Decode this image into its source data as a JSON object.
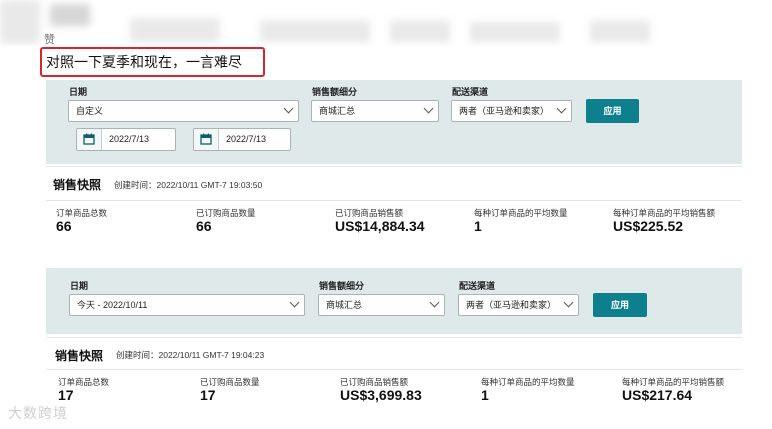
{
  "header": {
    "author_label": "赞",
    "comment": "对照一下夏季和现在，一言难尽"
  },
  "icons": {
    "calendar": "calendar-icon",
    "chevron": "chevron-down-icon"
  },
  "colors": {
    "accent": "#0e7f8d",
    "panel": "#dfe9ea",
    "highlight": "#d9242b"
  },
  "report1": {
    "filters": {
      "date_label": "日期",
      "date_value": "自定义",
      "start_date": "2022/7/13",
      "end_date": "2022/7/13",
      "breakdown_label": "销售额细分",
      "breakdown_value": "商城汇总",
      "channel_label": "配送渠道",
      "channel_value": "两者（亚马逊和卖家）",
      "apply": "应用"
    },
    "snapshot": {
      "title": "销售快照",
      "created": "创建时间：2022/10/11 GMT-7 19:03:50",
      "metrics": [
        {
          "label": "订单商品总数",
          "value": "66"
        },
        {
          "label": "已订购商品数量",
          "value": "66"
        },
        {
          "label": "已订购商品销售额",
          "value": "US$14,884.34"
        },
        {
          "label": "每种订单商品的平均数量",
          "value": "1"
        },
        {
          "label": "每种订单商品的平均销售额",
          "value": "US$225.52"
        }
      ]
    }
  },
  "report2": {
    "filters": {
      "date_label": "日期",
      "date_value": "今天 - 2022/10/11",
      "breakdown_label": "销售额细分",
      "breakdown_value": "商城汇总",
      "channel_label": "配送渠道",
      "channel_value": "两者（亚马逊和卖家）",
      "apply": "应用"
    },
    "snapshot": {
      "title": "销售快照",
      "created": "创建时间：2022/10/11 GMT-7 19:04:23",
      "metrics": [
        {
          "label": "订单商品总数",
          "value": "17"
        },
        {
          "label": "已订购商品数量",
          "value": "17"
        },
        {
          "label": "已订购商品销售额",
          "value": "US$3,699.83"
        },
        {
          "label": "每种订单商品的平均数量",
          "value": "1"
        },
        {
          "label": "每种订单商品的平均销售额",
          "value": "US$217.64"
        }
      ]
    }
  },
  "watermark": "大数跨境"
}
